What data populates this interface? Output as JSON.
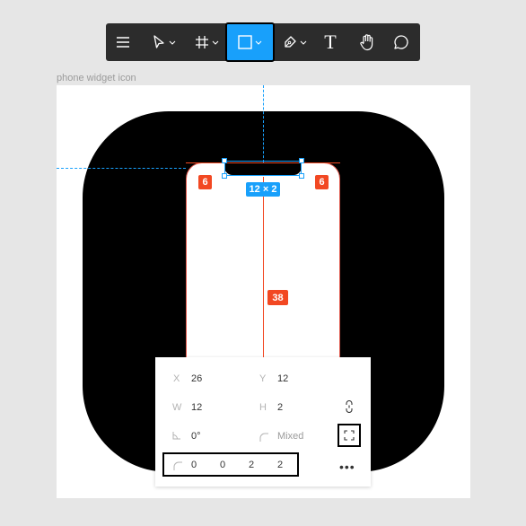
{
  "toolbar": {
    "tools": [
      {
        "name": "main-menu",
        "icon": "hamburger-icon"
      },
      {
        "name": "move",
        "icon": "cursor-arrow-icon",
        "dropdown": true
      },
      {
        "name": "frame",
        "icon": "frame-hash-icon",
        "dropdown": true
      },
      {
        "name": "rectangle",
        "icon": "rectangle-icon",
        "dropdown": true,
        "active": true
      },
      {
        "name": "pen",
        "icon": "pen-icon",
        "dropdown": true
      },
      {
        "name": "text",
        "icon": "text-t-icon",
        "label": "T"
      },
      {
        "name": "hand",
        "icon": "hand-icon"
      },
      {
        "name": "comment",
        "icon": "comment-bubble-icon"
      }
    ],
    "active_color": "#18a0fb",
    "background": "#2c2c2c"
  },
  "canvas": {
    "frame_label": "phone widget icon",
    "badges": {
      "corner_left": "6",
      "corner_right": "6",
      "size": "12 × 2",
      "height": "38"
    },
    "colors": {
      "measure": "#f24822",
      "selection": "#18a0fb"
    }
  },
  "panel": {
    "x_label": "X",
    "x_value": "26",
    "y_label": "Y",
    "y_value": "12",
    "w_label": "W",
    "w_value": "12",
    "h_label": "H",
    "h_value": "2",
    "rotation_value": "0°",
    "radius_value": "Mixed",
    "corners": [
      "0",
      "0",
      "2",
      "2"
    ],
    "more": "•••"
  }
}
